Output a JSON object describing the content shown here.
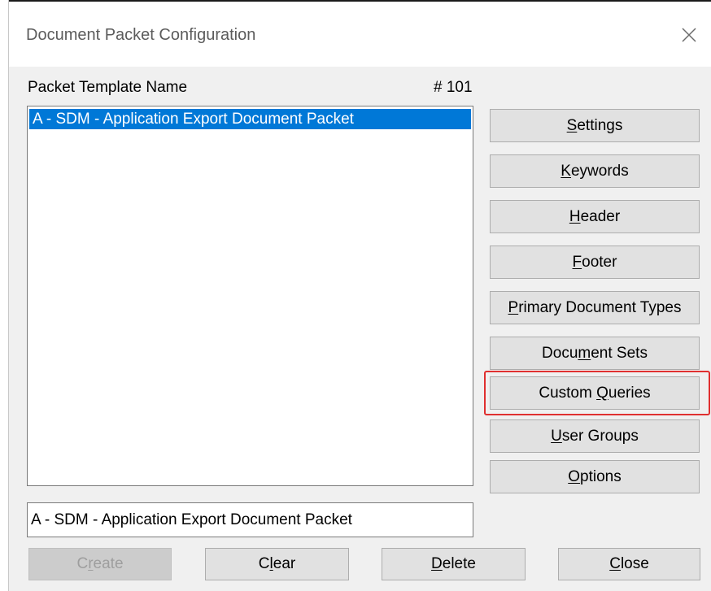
{
  "window": {
    "title": "Document Packet Configuration"
  },
  "labels": {
    "packet_template_name": "Packet Template Name",
    "packet_number": "# 101"
  },
  "list": {
    "items": [
      {
        "label": "A - SDM - Application Export Document Packet",
        "selected": true
      }
    ]
  },
  "name_field": {
    "value": "A - SDM - Application Export Document Packet"
  },
  "side_buttons": {
    "settings": {
      "pre": "",
      "key": "S",
      "post": "ettings"
    },
    "keywords": {
      "pre": "",
      "key": "K",
      "post": "eywords"
    },
    "header": {
      "pre": "",
      "key": "H",
      "post": "eader"
    },
    "footer": {
      "pre": "",
      "key": "F",
      "post": "ooter"
    },
    "primary_types": {
      "pre": "",
      "key": "P",
      "post": "rimary Document Types"
    },
    "document_sets": {
      "pre": "Docu",
      "key": "m",
      "post": "ent Sets"
    },
    "custom_queries": {
      "pre": "Custom ",
      "key": "Q",
      "post": "ueries"
    },
    "user_groups": {
      "pre": "",
      "key": "U",
      "post": "ser Groups"
    },
    "options": {
      "pre": "",
      "key": "O",
      "post": "ptions"
    }
  },
  "bottom_buttons": {
    "create": {
      "pre": "C",
      "key": "r",
      "post": "eate",
      "disabled": true
    },
    "clear": {
      "pre": "C",
      "key": "l",
      "post": "ear"
    },
    "delete": {
      "pre": "",
      "key": "D",
      "post": "elete"
    },
    "close": {
      "pre": "",
      "key": "C",
      "post": "lose"
    }
  },
  "colors": {
    "selection": "#0078d7",
    "highlight": "#e03030"
  }
}
